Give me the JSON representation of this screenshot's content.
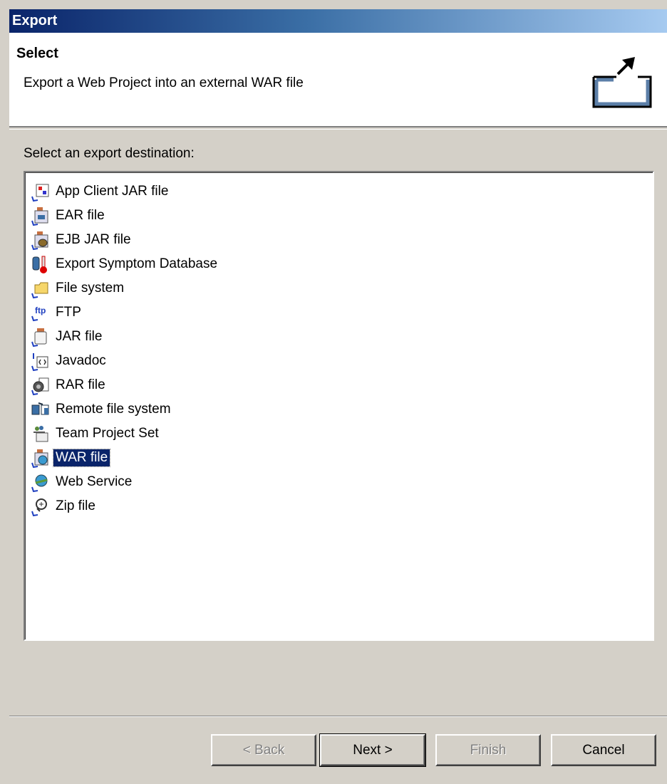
{
  "window": {
    "title": "Export"
  },
  "header": {
    "title": "Select",
    "description": "Export a Web Project into an external WAR file",
    "icon": "export-wizard-icon"
  },
  "destination_label": "Select an export destination:",
  "destinations": [
    {
      "label": "App Client JAR file",
      "icon": "app-client-jar-icon"
    },
    {
      "label": "EAR file",
      "icon": "ear-file-icon"
    },
    {
      "label": "EJB JAR file",
      "icon": "ejb-jar-icon"
    },
    {
      "label": "Export Symptom Database",
      "icon": "symptom-database-icon"
    },
    {
      "label": "File system",
      "icon": "folder-icon"
    },
    {
      "label": "FTP",
      "icon": "ftp-icon"
    },
    {
      "label": "JAR file",
      "icon": "jar-file-icon"
    },
    {
      "label": "Javadoc",
      "icon": "javadoc-icon"
    },
    {
      "label": "RAR file",
      "icon": "rar-file-icon"
    },
    {
      "label": "Remote file system",
      "icon": "remote-file-system-icon"
    },
    {
      "label": "Team Project Set",
      "icon": "team-project-set-icon"
    },
    {
      "label": "WAR file",
      "icon": "war-file-icon",
      "selected": true
    },
    {
      "label": "Web Service",
      "icon": "web-service-icon"
    },
    {
      "label": "Zip file",
      "icon": "zip-file-icon"
    }
  ],
  "buttons": {
    "back": "< Back",
    "next": "Next >",
    "finish": "Finish",
    "cancel": "Cancel"
  },
  "colors": {
    "title_gradient_start": "#0a246a",
    "title_gradient_end": "#a6caf0",
    "selection": "#0a246a",
    "dialog_bg": "#d4d0c8"
  }
}
